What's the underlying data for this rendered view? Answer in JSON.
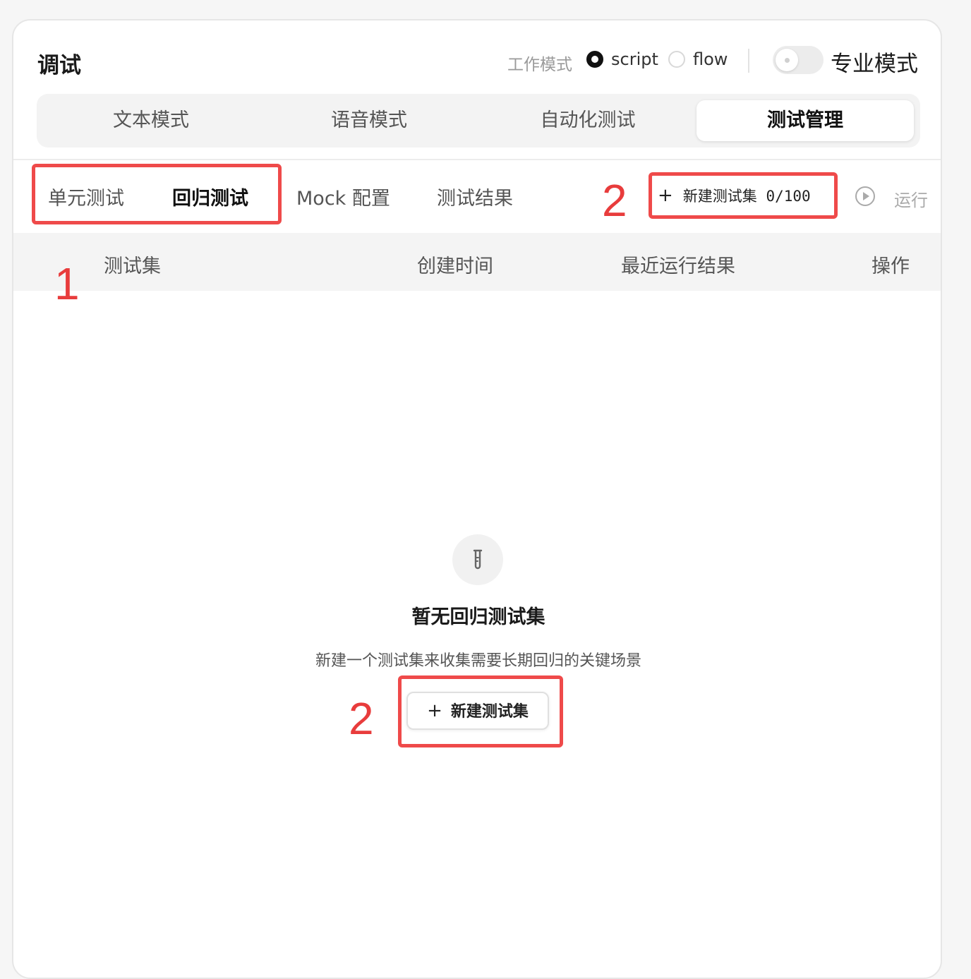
{
  "header": {
    "title": "调试",
    "work_mode_label": "工作模式",
    "mode_options": [
      "script",
      "flow"
    ],
    "selected_mode": "script",
    "pro_mode_label": "专业模式",
    "pro_mode_on": false
  },
  "main_tabs": [
    {
      "label": "文本模式",
      "active": false
    },
    {
      "label": "语音模式",
      "active": false
    },
    {
      "label": "自动化测试",
      "active": false
    },
    {
      "label": "测试管理",
      "active": true
    }
  ],
  "sub_tabs": [
    {
      "label": "单元测试",
      "active": false
    },
    {
      "label": "回归测试",
      "active": true
    },
    {
      "label": "Mock 配置",
      "active": false
    },
    {
      "label": "测试结果",
      "active": false
    }
  ],
  "toolbar": {
    "new_set_label": "新建测试集 0/100",
    "run_label": "运行"
  },
  "table": {
    "columns": [
      "测试集",
      "创建时间",
      "最近运行结果",
      "操作"
    ],
    "rows": []
  },
  "empty_state": {
    "icon": "test-tube-icon",
    "title": "暂无回归测试集",
    "description": "新建一个测试集来收集需要长期回归的关键场景",
    "button_label": "新建测试集"
  },
  "annotations": [
    "1",
    "2",
    "2"
  ],
  "colors": {
    "annotation_red": "#ef4a4a",
    "panel_bg": "#ffffff",
    "page_bg": "#f6f6f6"
  }
}
